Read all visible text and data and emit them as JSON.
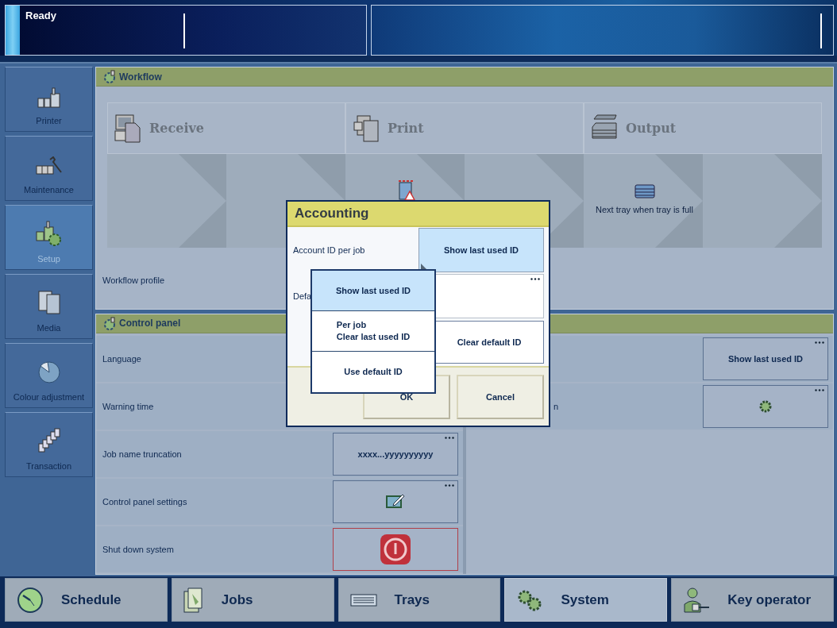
{
  "status_bar": {
    "message": "Ready"
  },
  "sidebar": {
    "items": [
      {
        "label": "Printer",
        "kind": "printer",
        "selected": false
      },
      {
        "label": "Maintenance",
        "kind": "maintenance",
        "selected": false
      },
      {
        "label": "Setup",
        "kind": "setup",
        "selected": true
      },
      {
        "label": "Media",
        "kind": "media",
        "selected": false
      },
      {
        "label": "Colour adjustment",
        "kind": "colour",
        "selected": false
      },
      {
        "label": "Transaction",
        "kind": "transaction",
        "selected": false
      }
    ]
  },
  "workflow": {
    "title": "Workflow",
    "stages": [
      {
        "label": "Receive",
        "kind": "receive"
      },
      {
        "label": "Print",
        "kind": "print"
      },
      {
        "label": "Output",
        "kind": "output"
      }
    ],
    "steps": [
      {
        "kind": "empty"
      },
      {
        "kind": "empty"
      },
      {
        "kind": "warning"
      },
      {
        "kind": "empty"
      },
      {
        "kind": "tray",
        "label": "Next tray when tray is full"
      },
      {
        "kind": "empty"
      }
    ],
    "profile_label": "Workflow profile"
  },
  "control_panel": {
    "title": "Control panel",
    "left_rows": [
      {
        "label": "Language"
      },
      {
        "label": "Warning time"
      },
      {
        "label": "Job name truncation",
        "kind": "text",
        "value": "xxxx...yyyyyyyyyy",
        "more": true
      },
      {
        "label": "Control panel settings",
        "kind": "edit",
        "more": true
      },
      {
        "label": "Shut down system",
        "kind": "power",
        "more": false
      }
    ],
    "right_rows": [
      {
        "kind": "text",
        "value": "Show last used ID",
        "more": true
      },
      {
        "label": "n",
        "kind": "gear",
        "more": true
      }
    ]
  },
  "dialog": {
    "title": "Accounting",
    "rows": [
      {
        "kind": "choice",
        "label": "Account ID per job",
        "value": "Show last used ID"
      },
      {
        "kind": "field",
        "label": "Defa",
        "more": true
      },
      {
        "kind": "button",
        "value": "Clear default ID"
      }
    ],
    "buttons": [
      "OK",
      "Cancel"
    ],
    "dropdown": [
      {
        "label": "Show last used ID",
        "selected": true
      },
      {
        "label": "Per job\nClear last used ID",
        "selected": false
      },
      {
        "label": "Use default ID",
        "selected": false
      }
    ]
  },
  "nav": {
    "tabs": [
      {
        "label": "Schedule",
        "kind": "schedule",
        "selected": false
      },
      {
        "label": "Jobs",
        "kind": "jobs",
        "selected": false
      },
      {
        "label": "Trays",
        "kind": "trays",
        "selected": false
      },
      {
        "label": "System",
        "kind": "system",
        "selected": true
      },
      {
        "label": "Key operator",
        "kind": "keyop",
        "selected": false
      }
    ]
  }
}
